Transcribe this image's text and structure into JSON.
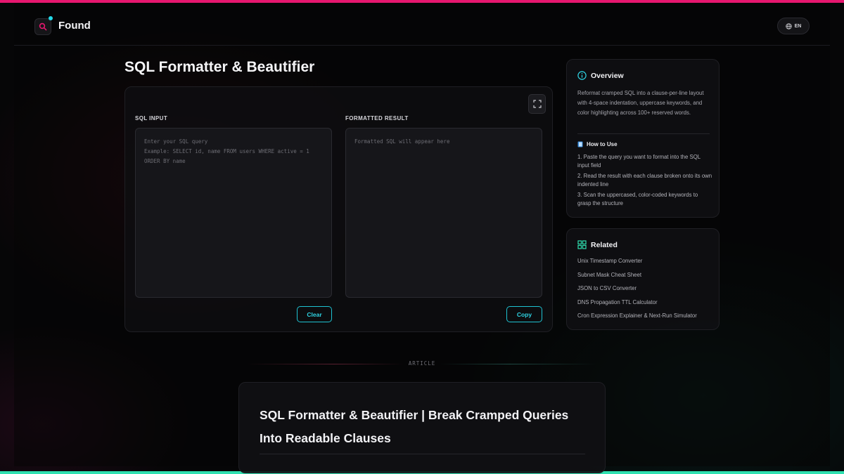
{
  "app": {
    "brand": "Found",
    "language": "EN"
  },
  "page": {
    "title": "SQL Formatter & Beautifier"
  },
  "tool": {
    "input_label": "SQL INPUT",
    "input_placeholder": "Enter your SQL query\nExample: SELECT id, name FROM users WHERE active = 1\nORDER BY name",
    "output_label": "FORMATTED RESULT",
    "output_placeholder": "Formatted SQL will appear here",
    "clear_label": "Clear",
    "copy_label": "Copy"
  },
  "overview": {
    "title": "Overview",
    "text": "Reformat cramped SQL into a clause-per-line layout with 4-space indentation, uppercase keywords, and color highlighting across 100+ reserved words.",
    "howto_title": "How to Use",
    "steps": [
      "1. Paste the query you want to format into the SQL input field",
      "2. Read the result with each clause broken onto its own indented line",
      "3. Scan the uppercased, color-coded keywords to grasp the structure"
    ]
  },
  "related": {
    "title": "Related",
    "items": [
      "Unix Timestamp Converter",
      "Subnet Mask Cheat Sheet",
      "JSON to CSV Converter",
      "DNS Propagation TTL Calculator",
      "Cron Expression Explainer & Next-Run Simulator"
    ]
  },
  "article": {
    "label": "ARTICLE",
    "title": "SQL Formatter & Beautifier | Break Cramped Queries Into Readable Clauses"
  },
  "colors": {
    "accent_pink": "#e6176f",
    "accent_cyan": "#2ed3e2",
    "accent_green": "#2fe0b0"
  },
  "icons": {
    "logo": "search-icon",
    "language": "globe-icon",
    "expand": "fullscreen-icon",
    "overview": "info-icon",
    "howto": "book-icon",
    "related": "grid-icon"
  }
}
